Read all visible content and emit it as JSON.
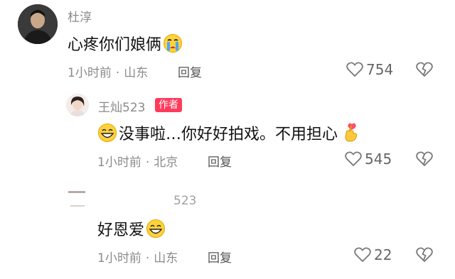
{
  "comments": [
    {
      "username": "杜淳",
      "text": "心疼你们娘俩",
      "emoji_after": "crying-face",
      "time": "1小时前",
      "location": "山东",
      "reply_label": "回复",
      "likes": "754"
    },
    {
      "username": "王灿523",
      "badge": "作者",
      "emoji_before": "grinning-face",
      "text": "没事啦…你好好拍戏。不用担心",
      "emoji_after": "finger-heart",
      "time": "1小时前",
      "location": "北京",
      "reply_label": "回复",
      "likes": "545"
    },
    {
      "username": "523",
      "text": "好恩爱",
      "emoji_after": "grinning-face",
      "time": "1小时前",
      "location": "山东",
      "reply_label": "回复",
      "likes": "22"
    }
  ],
  "separator": "·"
}
